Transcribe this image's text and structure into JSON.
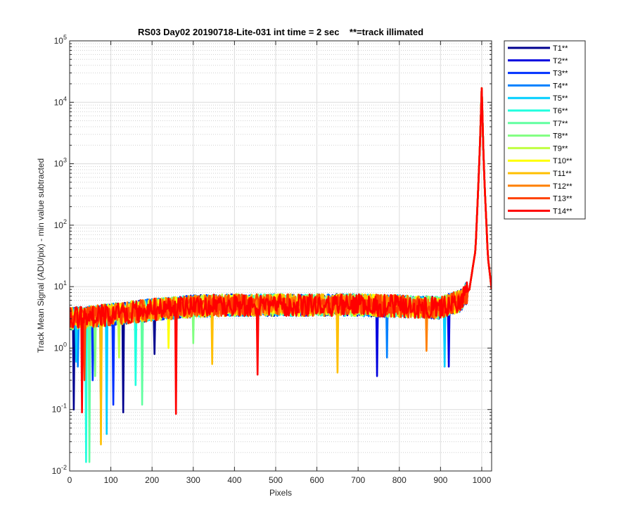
{
  "chart_data": {
    "type": "line",
    "title": "RS03 Day02 20190718-Lite-031 int time = 2 sec    **=track illimated",
    "xlabel": "Pixels",
    "ylabel": "Track Mean Signal (ADU/pix) - min value subtracted",
    "xlim": [
      0,
      1024
    ],
    "ylim": [
      0.01,
      100000
    ],
    "yscale": "log",
    "grid": true,
    "minor_grid": true,
    "legend_position": "outside-right",
    "x_ticks": [
      0,
      100,
      200,
      300,
      400,
      500,
      600,
      700,
      800,
      900,
      1000
    ],
    "x_tick_labels": [
      "0",
      "100",
      "200",
      "300",
      "400",
      "500",
      "600",
      "700",
      "800",
      "900",
      "1000"
    ],
    "y_ticks": [
      0.01,
      0.1,
      1,
      10,
      100,
      1000,
      10000,
      100000
    ],
    "y_tick_labels": [
      {
        "base": "10",
        "exp": "-2"
      },
      {
        "base": "10",
        "exp": "-1"
      },
      {
        "base": "10",
        "exp": "0"
      },
      {
        "base": "10",
        "exp": "1"
      },
      {
        "base": "10",
        "exp": "2"
      },
      {
        "base": "10",
        "exp": "3"
      },
      {
        "base": "10",
        "exp": "4"
      },
      {
        "base": "10",
        "exp": "5"
      }
    ],
    "baseline": {
      "x": [
        0,
        50,
        100,
        200,
        300,
        400,
        500,
        600,
        700,
        800,
        900,
        950,
        970,
        985,
        995,
        1000,
        1005,
        1015,
        1024
      ],
      "y": [
        3,
        3.2,
        3.5,
        4.2,
        4.8,
        5,
        5,
        5,
        5,
        4.8,
        4.5,
        6,
        9,
        40,
        1500,
        17000,
        900,
        30,
        9
      ]
    },
    "series": [
      {
        "name": "T1**",
        "color": "#00008F",
        "dips": [
          [
            10,
            0.1
          ],
          [
            130,
            0.09
          ],
          [
            205,
            0.8
          ]
        ]
      },
      {
        "name": "T2**",
        "color": "#0000DF",
        "dips": [
          [
            75,
            0.07
          ],
          [
            745,
            0.35
          ],
          [
            920,
            0.5
          ]
        ]
      },
      {
        "name": "T3**",
        "color": "#0030FF",
        "dips": [
          [
            105,
            0.12
          ],
          [
            55,
            0.3
          ]
        ]
      },
      {
        "name": "T4**",
        "color": "#0080FF",
        "dips": [
          [
            20,
            0.5
          ],
          [
            770,
            0.7
          ]
        ]
      },
      {
        "name": "T5**",
        "color": "#00CFFF",
        "dips": [
          [
            90,
            0.04
          ],
          [
            15,
            0.6
          ],
          [
            910,
            0.5
          ]
        ]
      },
      {
        "name": "T6**",
        "color": "#20FFDF",
        "dips": [
          [
            40,
            0.014
          ],
          [
            160,
            0.25
          ]
        ]
      },
      {
        "name": "T7**",
        "color": "#60FFA0",
        "dips": [
          [
            48,
            0.014
          ],
          [
            175,
            0.12
          ]
        ]
      },
      {
        "name": "T8**",
        "color": "#80FF80",
        "dips": [
          [
            62,
            0.35
          ],
          [
            300,
            1.2
          ]
        ]
      },
      {
        "name": "T9**",
        "color": "#C0FF40",
        "dips": [
          [
            120,
            0.7
          ]
        ]
      },
      {
        "name": "T10**",
        "color": "#FFFF00",
        "dips": [
          [
            240,
            1.0
          ]
        ]
      },
      {
        "name": "T11**",
        "color": "#FFBF00",
        "dips": [
          [
            75,
            0.027
          ],
          [
            345,
            0.55
          ],
          [
            650,
            0.4
          ]
        ]
      },
      {
        "name": "T12**",
        "color": "#FF8000",
        "dips": [
          [
            865,
            0.9
          ]
        ]
      },
      {
        "name": "T13**",
        "color": "#FF4000",
        "dips": [
          [
            35,
            0.3
          ]
        ]
      },
      {
        "name": "T14**",
        "color": "#FF0000",
        "dips": [
          [
            30,
            0.09
          ],
          [
            258,
            0.085
          ],
          [
            455,
            0.37
          ]
        ]
      }
    ]
  }
}
